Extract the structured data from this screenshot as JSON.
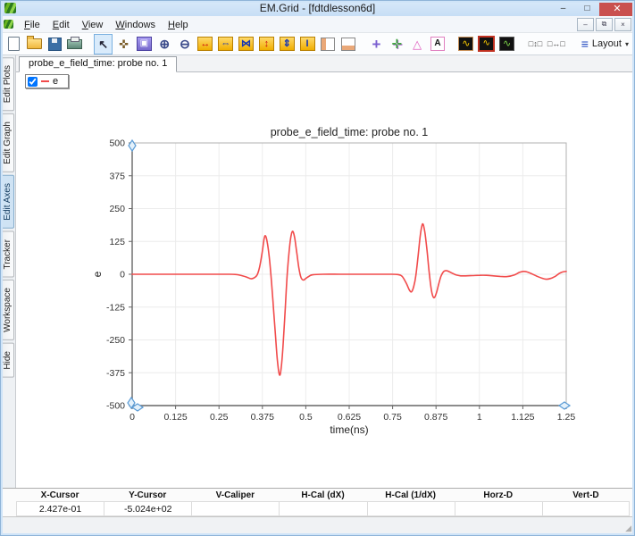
{
  "window": {
    "title": "EM.Grid - [fdtdlesson6d]",
    "controls": {
      "minimize": "–",
      "maximize": "□",
      "close": "✕"
    },
    "mdi_controls": {
      "minimize": "–",
      "restore": "⧉",
      "close": "×"
    }
  },
  "menu": {
    "items": [
      "File",
      "Edit",
      "View",
      "Windows",
      "Help"
    ]
  },
  "toolbar": {
    "layout_label": "Layout",
    "layout_bars_glyph": "≡",
    "layout_caret_glyph": "▾",
    "items": [
      {
        "name": "new-file-icon",
        "glyph": "",
        "cls": "ic-page"
      },
      {
        "name": "open-file-icon",
        "glyph": "",
        "cls": "ic-folder"
      },
      {
        "name": "save-icon",
        "glyph": "",
        "cls": "ic-save"
      },
      {
        "name": "print-icon",
        "glyph": "",
        "cls": "ic-print"
      },
      {
        "name": "select-arrow-icon",
        "glyph": "↖",
        "cls": "ic-arrow",
        "active": true,
        "gap": true
      },
      {
        "name": "pan-hand-icon",
        "glyph": "✜",
        "cls": "ic-hand"
      },
      {
        "name": "zoom-region-icon",
        "glyph": "▣",
        "cls": "ic-zoombox"
      },
      {
        "name": "zoom-in-icon",
        "glyph": "⊕",
        "cls": "ic-zoomin"
      },
      {
        "name": "zoom-out-icon",
        "glyph": "⊖",
        "cls": "ic-zoomout"
      },
      {
        "name": "expand-x-icon",
        "glyph": "↔",
        "cls": "ic-yel ic-red"
      },
      {
        "name": "stretch-x-icon",
        "glyph": "⇔",
        "cls": "ic-yel ic-blue"
      },
      {
        "name": "compress-x-icon",
        "glyph": "⋈",
        "cls": "ic-yel ic-blue"
      },
      {
        "name": "expand-y-icon",
        "glyph": "↕",
        "cls": "ic-yel ic-red"
      },
      {
        "name": "stretch-y-icon",
        "glyph": "⇕",
        "cls": "ic-yel ic-blue"
      },
      {
        "name": "compress-y-icon",
        "glyph": "I",
        "cls": "ic-yel ic-blue"
      },
      {
        "name": "left-panel-icon",
        "glyph": "",
        "cls": "ic-colL"
      },
      {
        "name": "bottom-panel-icon",
        "glyph": "",
        "cls": "ic-colB"
      },
      {
        "name": "crosshair-icon",
        "glyph": "+",
        "cls": "ic-plus",
        "gap": true
      },
      {
        "name": "axes-icon",
        "glyph": "✛",
        "cls": "ic-axes"
      },
      {
        "name": "angle-marker-icon",
        "glyph": "△",
        "cls": "ic-tri"
      },
      {
        "name": "text-label-icon",
        "glyph": "A",
        "cls": "ic-A"
      },
      {
        "name": "plot-style-icon",
        "glyph": "∿",
        "cls": "ic-wave1",
        "gap": true
      },
      {
        "name": "plot-dark-icon",
        "glyph": "∿",
        "cls": "ic-wave2"
      },
      {
        "name": "plot-multi-icon",
        "glyph": "∿",
        "cls": "ic-wave3"
      },
      {
        "name": "vertical-spacing-icon",
        "glyph": "□↕□",
        "cls": "ic-sp",
        "gap": true
      },
      {
        "name": "horizontal-spacing-icon",
        "glyph": "□↔□",
        "cls": "ic-sp"
      }
    ]
  },
  "sidebar": {
    "tabs": [
      "Edit Plots",
      "Edit Graph",
      "Edit Axes",
      "Tracker",
      "Workspace",
      "Hide"
    ],
    "selected_index": 2
  },
  "tabs": [
    {
      "label": "probe_e_field_time: probe no. 1"
    }
  ],
  "legend": {
    "label": "e",
    "checked": true,
    "color": "#f14b4b"
  },
  "chart_data": {
    "type": "line",
    "title": "probe_e_field_time: probe no. 1",
    "xlabel": "time(ns)",
    "ylabel": "e",
    "xlim": [
      0,
      1.25
    ],
    "ylim": [
      -500,
      500
    ],
    "xticks": [
      0,
      0.125,
      0.25,
      0.375,
      0.5,
      0.625,
      0.75,
      0.875,
      1,
      1.125,
      1.25
    ],
    "xtick_labels": [
      "0",
      "0.125",
      "0.25",
      "0.375",
      "0.5",
      "0.625",
      "0.75",
      "0.875",
      "1",
      "1.125",
      "1.25"
    ],
    "yticks": [
      500,
      375,
      250,
      125,
      0,
      -125,
      -250,
      -375,
      -500
    ],
    "grid": true,
    "legend_position": "top-left",
    "line_color": "#f14b4b",
    "series": [
      {
        "name": "e",
        "points": [
          [
            0,
            0
          ],
          [
            0.06,
            0
          ],
          [
            0.12,
            0
          ],
          [
            0.18,
            0
          ],
          [
            0.24,
            0
          ],
          [
            0.28,
            0
          ],
          [
            0.3,
            -1
          ],
          [
            0.315,
            -5
          ],
          [
            0.33,
            -11
          ],
          [
            0.342,
            -17
          ],
          [
            0.352,
            -13
          ],
          [
            0.36,
            -2
          ],
          [
            0.367,
            28
          ],
          [
            0.374,
            80
          ],
          [
            0.38,
            135
          ],
          [
            0.384,
            146
          ],
          [
            0.389,
            122
          ],
          [
            0.395,
            62
          ],
          [
            0.401,
            -25
          ],
          [
            0.407,
            -130
          ],
          [
            0.413,
            -240
          ],
          [
            0.418,
            -325
          ],
          [
            0.424,
            -383
          ],
          [
            0.429,
            -358
          ],
          [
            0.435,
            -262
          ],
          [
            0.441,
            -125
          ],
          [
            0.447,
            10
          ],
          [
            0.453,
            100
          ],
          [
            0.458,
            150
          ],
          [
            0.463,
            163
          ],
          [
            0.468,
            138
          ],
          [
            0.474,
            82
          ],
          [
            0.48,
            25
          ],
          [
            0.486,
            -12
          ],
          [
            0.493,
            -22
          ],
          [
            0.5,
            -16
          ],
          [
            0.51,
            -7
          ],
          [
            0.52,
            -2
          ],
          [
            0.55,
            0
          ],
          [
            0.6,
            0
          ],
          [
            0.65,
            0
          ],
          [
            0.7,
            0
          ],
          [
            0.74,
            0
          ],
          [
            0.765,
            -1
          ],
          [
            0.778,
            -9
          ],
          [
            0.79,
            -36
          ],
          [
            0.799,
            -62
          ],
          [
            0.805,
            -66
          ],
          [
            0.811,
            -46
          ],
          [
            0.817,
            -5
          ],
          [
            0.823,
            65
          ],
          [
            0.829,
            140
          ],
          [
            0.834,
            183
          ],
          [
            0.838,
            190
          ],
          [
            0.843,
            158
          ],
          [
            0.849,
            92
          ],
          [
            0.855,
            12
          ],
          [
            0.861,
            -55
          ],
          [
            0.866,
            -84
          ],
          [
            0.871,
            -88
          ],
          [
            0.877,
            -67
          ],
          [
            0.883,
            -36
          ],
          [
            0.889,
            -9
          ],
          [
            0.896,
            9
          ],
          [
            0.904,
            14
          ],
          [
            0.913,
            10
          ],
          [
            0.923,
            3
          ],
          [
            0.934,
            -3
          ],
          [
            0.946,
            -6
          ],
          [
            0.96,
            -6
          ],
          [
            0.98,
            -5
          ],
          [
            1.0,
            -4
          ],
          [
            1.02,
            -4
          ],
          [
            1.04,
            -6
          ],
          [
            1.06,
            -8
          ],
          [
            1.08,
            -9
          ],
          [
            1.1,
            -3
          ],
          [
            1.115,
            7
          ],
          [
            1.126,
            11
          ],
          [
            1.137,
            9
          ],
          [
            1.15,
            2
          ],
          [
            1.165,
            -7
          ],
          [
            1.18,
            -15
          ],
          [
            1.193,
            -19
          ],
          [
            1.205,
            -16
          ],
          [
            1.218,
            -8
          ],
          [
            1.23,
            3
          ],
          [
            1.24,
            9
          ],
          [
            1.25,
            11
          ]
        ]
      }
    ]
  },
  "statusbar": {
    "columns": [
      {
        "label": "X-Cursor",
        "value": "2.427e-01"
      },
      {
        "label": "Y-Cursor",
        "value": "-5.024e+02"
      },
      {
        "label": "V-Caliper",
        "value": ""
      },
      {
        "label": "H-Cal (dX)",
        "value": ""
      },
      {
        "label": "H-Cal (1/dX)",
        "value": ""
      },
      {
        "label": "Horz-D",
        "value": ""
      },
      {
        "label": "Vert-D",
        "value": ""
      }
    ],
    "grip_glyph": "◢"
  }
}
